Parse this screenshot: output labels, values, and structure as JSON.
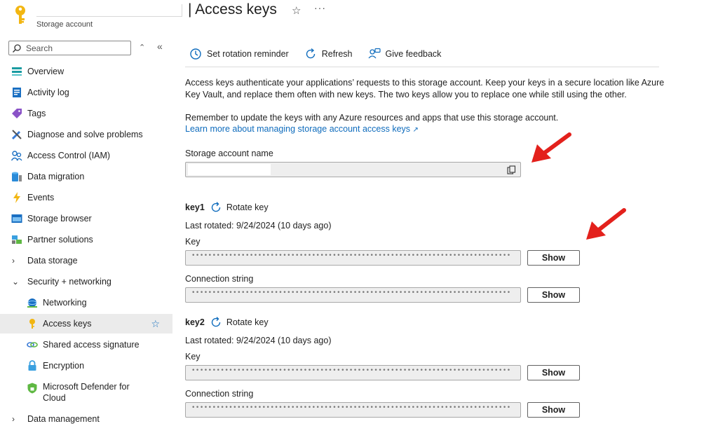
{
  "header": {
    "title": "| Access keys",
    "subtitle": "Storage account",
    "more": "···",
    "star": "☆"
  },
  "sidebar": {
    "search_placeholder": "Search",
    "items": [
      {
        "label": "Overview",
        "icon": "overview-icon"
      },
      {
        "label": "Activity log",
        "icon": "activity-log-icon"
      },
      {
        "label": "Tags",
        "icon": "tag-icon"
      },
      {
        "label": "Diagnose and solve problems",
        "icon": "wrench-icon"
      },
      {
        "label": "Access Control (IAM)",
        "icon": "people-icon"
      },
      {
        "label": "Data migration",
        "icon": "data-migration-icon"
      },
      {
        "label": "Events",
        "icon": "lightning-icon"
      },
      {
        "label": "Storage browser",
        "icon": "storage-browser-icon"
      },
      {
        "label": "Partner solutions",
        "icon": "partner-icon"
      },
      {
        "label": "Data storage",
        "icon": "chevron-right-icon"
      },
      {
        "label": "Security + networking",
        "icon": "chevron-down-icon"
      },
      {
        "label": "Networking",
        "icon": "networking-icon"
      },
      {
        "label": "Access keys",
        "icon": "key-icon"
      },
      {
        "label": "Shared access signature",
        "icon": "link-icon"
      },
      {
        "label": "Encryption",
        "icon": "lock-icon"
      },
      {
        "label": "Microsoft Defender for Cloud",
        "icon": "shield-icon"
      },
      {
        "label": "Data management",
        "icon": "chevron-right-icon"
      }
    ],
    "active_index": 12
  },
  "toolbar": {
    "rotation": "Set rotation reminder",
    "refresh": "Refresh",
    "feedback": "Give feedback"
  },
  "content": {
    "intro": "Access keys authenticate your applications’ requests to this storage account. Keep your keys in a secure location like Azure Key Vault, and replace them often with new keys. The two keys allow you to replace one while still using the other.",
    "reminder": "Remember to update the keys with any Azure resources and apps that use this storage account.",
    "learn_more": "Learn more about managing storage account access keys",
    "account_name_label": "Storage account name",
    "key1": {
      "name": "key1",
      "rotate": "Rotate key",
      "last_rotated": "Last rotated: 9/24/2024 (10 days ago)",
      "key_label": "Key",
      "key_value": "••••••••••••••••••••••••••••••••••••••••••••••••••••••••••••••••••••••••••••••••••••••••",
      "conn_label": "Connection string",
      "conn_value": "•••••••••••••••••••••••••••••••••••••••••••••••••••••••••••••••••••••••••••••••••••••••••••...",
      "show": "Show"
    },
    "key2": {
      "name": "key2",
      "rotate": "Rotate key",
      "last_rotated": "Last rotated: 9/24/2024 (10 days ago)",
      "key_label": "Key",
      "key_value": "••••••••••••••••••••••••••••••••••••••••••••••••••••••••••••••••••••••••••••••••••••••••",
      "conn_label": "Connection string",
      "conn_value": "•••••••••••••••••••••••••••••••••••••••••••••••••••••••••••••••••••••••••••••••••••••••••••...",
      "show": "Show"
    }
  },
  "colors": {
    "accent": "#0f6cbd",
    "annotation_arrow": "#e3211c",
    "active_row": "#ebebeb"
  }
}
